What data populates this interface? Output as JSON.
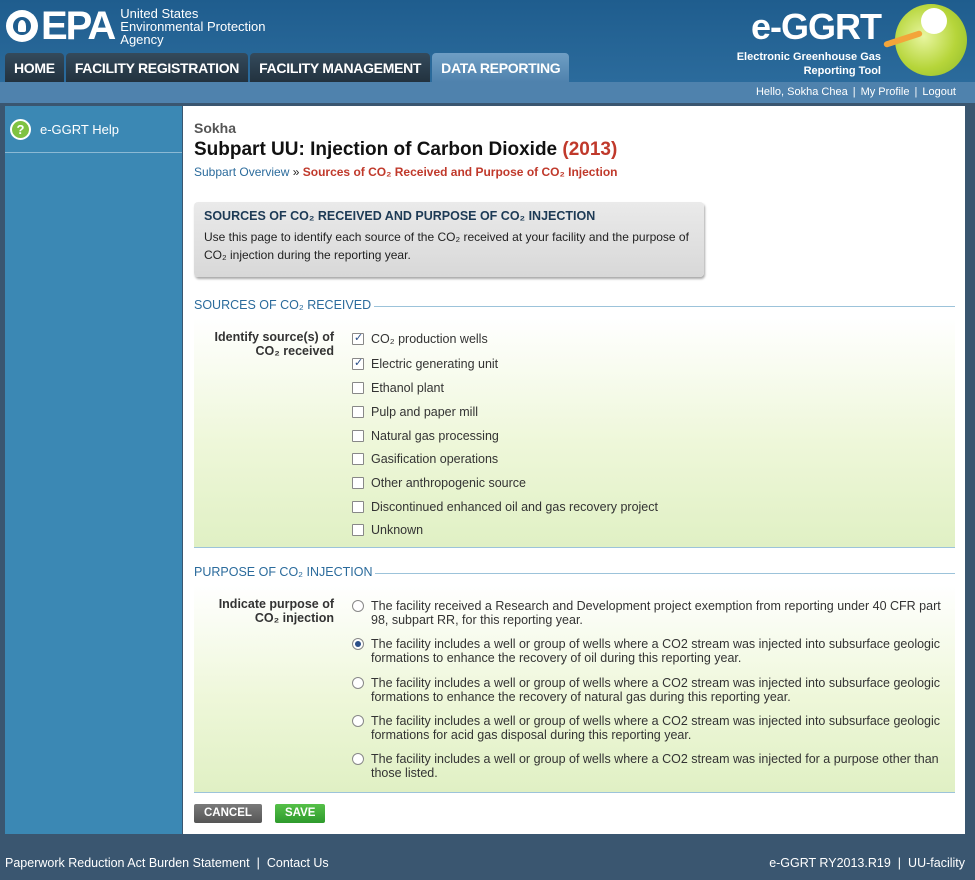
{
  "header": {
    "agency_line1": "United States",
    "agency_line2": "Environmental Protection",
    "agency_line3": "Agency",
    "epa_word": "EPA",
    "tool_title": "e-GGRT",
    "tool_sub1": "Electronic Greenhouse Gas",
    "tool_sub2": "Reporting Tool"
  },
  "tabs": [
    {
      "label": "HOME"
    },
    {
      "label": "FACILITY REGISTRATION"
    },
    {
      "label": "FACILITY MANAGEMENT"
    },
    {
      "label": "DATA REPORTING"
    }
  ],
  "userbar": {
    "greeting": "Hello, Sokha Chea",
    "profile": "My Profile",
    "logout": "Logout"
  },
  "sidebar": {
    "help_label": "e-GGRT Help",
    "help_glyph": "?"
  },
  "page": {
    "facility": "Sokha",
    "title": "Subpart UU: Injection of Carbon Dioxide",
    "year": "(2013)",
    "breadcrumb_link": "Subpart Overview",
    "breadcrumb_sep": "»",
    "breadcrumb_current": "Sources of CO₂ Received and Purpose of CO₂ Injection"
  },
  "infobox": {
    "title": "SOURCES OF CO₂ RECEIVED AND PURPOSE OF CO₂ INJECTION",
    "body": "Use this page to identify each source of the CO₂ received at your facility and the purpose of CO₂ injection during the reporting year."
  },
  "sources": {
    "legend": "SOURCES OF CO₂ RECEIVED",
    "label": "Identify source(s) of CO₂ received",
    "options": [
      {
        "label": "CO₂ production wells",
        "checked": true
      },
      {
        "label": "Electric generating unit",
        "checked": true
      },
      {
        "label": "Ethanol plant",
        "checked": false
      },
      {
        "label": "Pulp and paper mill",
        "checked": false
      },
      {
        "label": "Natural gas processing",
        "checked": false
      },
      {
        "label": "Gasification operations",
        "checked": false
      },
      {
        "label": "Other anthropogenic source",
        "checked": false
      },
      {
        "label": "Discontinued enhanced oil and gas recovery project",
        "checked": false
      },
      {
        "label": "Unknown",
        "checked": false
      }
    ]
  },
  "purpose": {
    "legend": "PURPOSE OF CO₂ INJECTION",
    "label": "Indicate purpose of CO₂ injection",
    "options": [
      {
        "label": "The facility received a Research and Development project exemption from reporting under 40 CFR part 98, subpart RR, for this reporting year.",
        "selected": false
      },
      {
        "label": "The facility includes a well or group of wells where a CO2 stream was injected into subsurface geologic formations to enhance the recovery of oil during this reporting year.",
        "selected": true
      },
      {
        "label": "The facility includes a well or group of wells where a CO2 stream was injected into subsurface geologic formations to enhance the recovery of natural gas during this reporting year.",
        "selected": false
      },
      {
        "label": "The facility includes a well or group of wells where a CO2 stream was injected into subsurface geologic formations for acid gas disposal during this reporting year.",
        "selected": false
      },
      {
        "label": "The facility includes a well or group of wells where a CO2 stream was injected for a purpose other than those listed.",
        "selected": false
      }
    ]
  },
  "buttons": {
    "cancel": "CANCEL",
    "save": "SAVE"
  },
  "footer": {
    "burden": "Paperwork Reduction Act Burden Statement",
    "contact": "Contact Us",
    "version": "e-GGRT RY2013.R19",
    "page_id": "UU-facility"
  }
}
